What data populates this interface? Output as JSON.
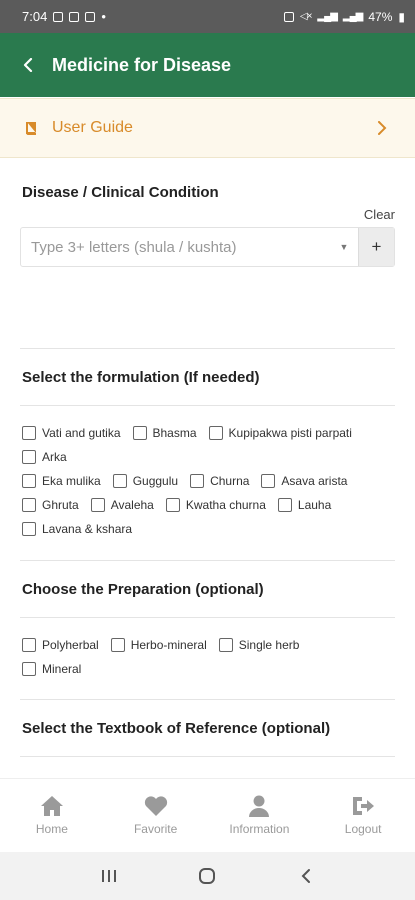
{
  "status": {
    "time": "7:04",
    "battery": "47%"
  },
  "header": {
    "title": "Medicine for Disease"
  },
  "guide": {
    "label": "User Guide"
  },
  "disease": {
    "title": "Disease / Clinical Condition",
    "clear_label": "Clear",
    "placeholder": "Type 3+ letters (shula / kushta)",
    "value": "",
    "add_label": "+"
  },
  "formulation": {
    "title": "Select the formulation (If needed)",
    "rows": [
      [
        "Vati and gutika",
        "Bhasma",
        "Kupipakwa pisti parpati"
      ],
      [
        "Arka"
      ],
      [
        "Eka mulika",
        "Guggulu",
        "Churna",
        "Asava arista"
      ],
      [
        "Ghruta",
        "Avaleha",
        "Kwatha churna",
        "Lauha"
      ],
      [
        "Lavana & kshara"
      ]
    ]
  },
  "preparation": {
    "title": "Choose the Preparation (optional)",
    "rows": [
      [
        "Polyherbal",
        "Herbo-mineral",
        "Single herb"
      ],
      [
        "Mineral"
      ]
    ]
  },
  "textbook": {
    "title": "Select the Textbook of Reference (optional)"
  },
  "nav": {
    "home": "Home",
    "favorite": "Favorite",
    "information": "Information",
    "logout": "Logout"
  },
  "colors": {
    "header": "#2a7a4e",
    "guide_accent": "#d88b2a",
    "nav_inactive": "#9a9a9a"
  }
}
